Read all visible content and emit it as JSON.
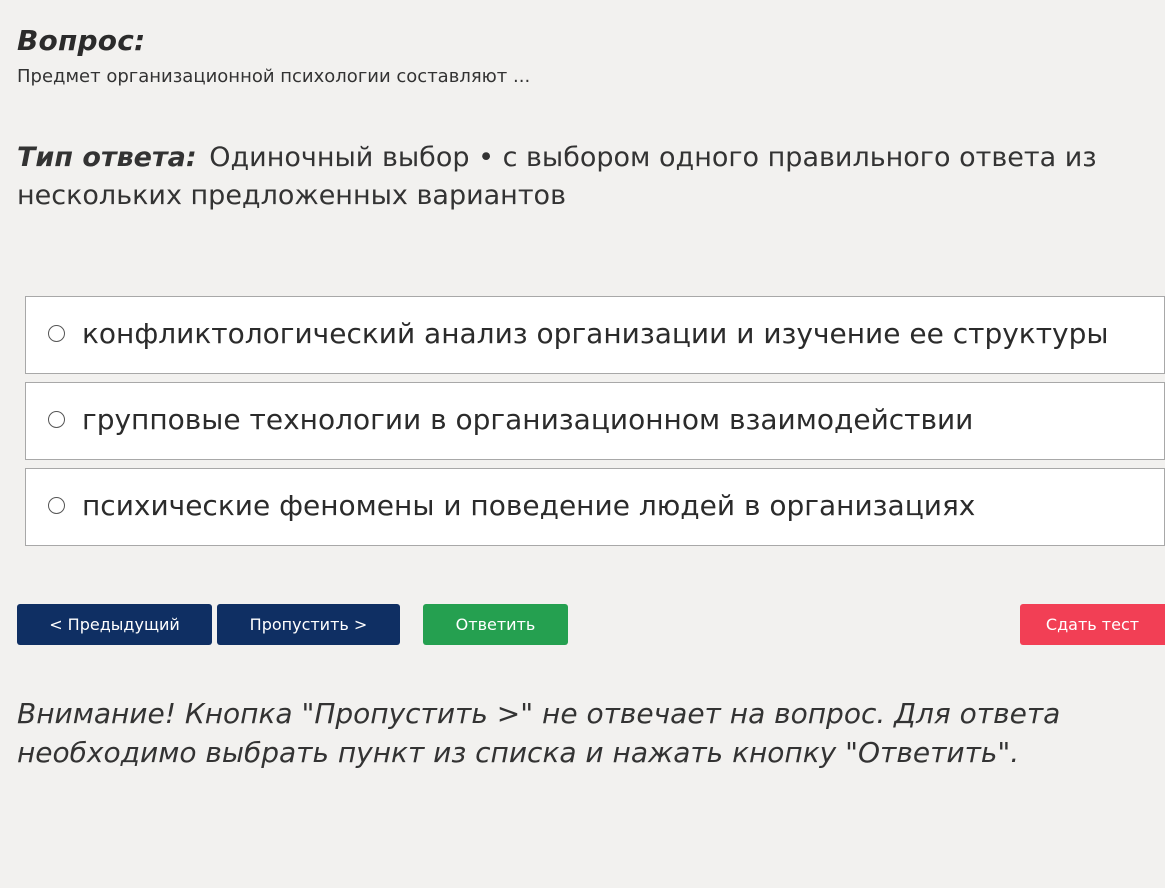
{
  "question": {
    "heading": "Вопрос:",
    "text": "Предмет организационной психологии составляют ..."
  },
  "answer_type": {
    "label": "Тип ответа:",
    "value": "Одиночный выбор • с выбором одного правильного ответа из нескольких предложенных вариантов"
  },
  "options": [
    {
      "label": "конфликтологический анализ организации и изучение ее структуры",
      "selected": false
    },
    {
      "label": "групповые технологии в организационном взаимодействии",
      "selected": false
    },
    {
      "label": "психические феномены и поведение людей в организациях",
      "selected": false
    }
  ],
  "buttons": {
    "prev": "< Предыдущий",
    "skip": "Пропустить >",
    "answer": "Ответить",
    "submit": "Сдать тест"
  },
  "colors": {
    "nav_button": "#0f2f63",
    "answer_button": "#25a050",
    "submit_button": "#f23f55",
    "background": "#f2f1ef"
  },
  "warning": "Внимание! Кнопка \"Пропустить >\" не отвечает на вопрос. Для ответа необходимо выбрать пункт из списка и нажать кнопку \"Ответить\"."
}
